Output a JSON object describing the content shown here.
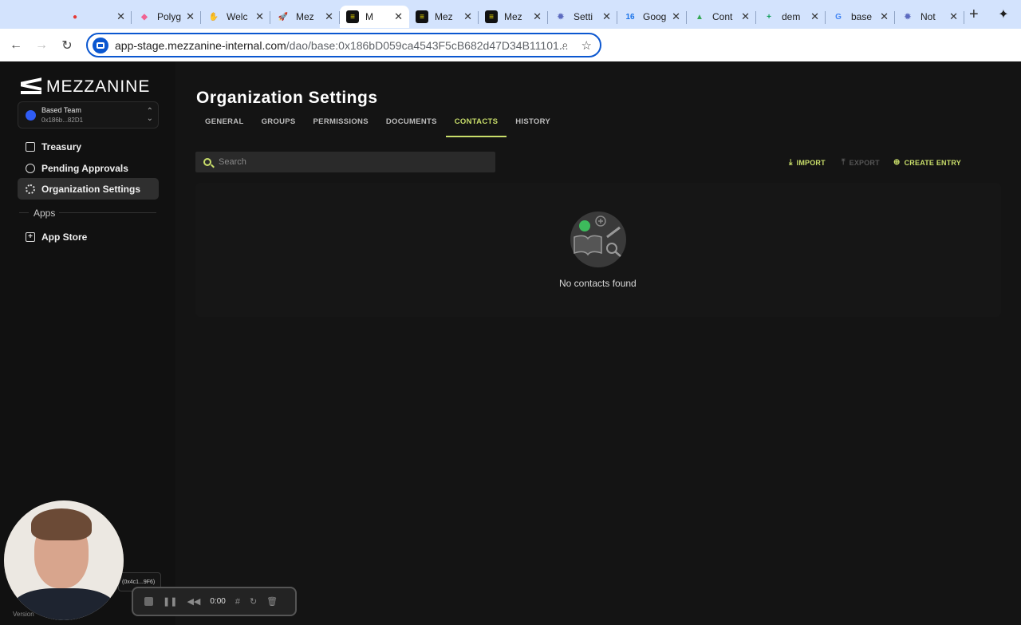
{
  "browser": {
    "tabs": [
      {
        "title": "",
        "fav": "●",
        "fav_color": "#e53935",
        "fav_text": "#e53935"
      },
      {
        "title": "Polyg",
        "fav": "◆",
        "fav_color": "#f06292",
        "fav_text": "#f06292"
      },
      {
        "title": "Welc",
        "fav": "✋",
        "fav_color": "#f9a825",
        "fav_text": "#f9a825"
      },
      {
        "title": "Mez",
        "fav": "🚀",
        "fav_color": "#e53935",
        "fav_text": "#e53935"
      },
      {
        "title": "M",
        "fav": "≡",
        "fav_color": "#111111",
        "fav_text": "#f0e000",
        "active": true
      },
      {
        "title": "Mez",
        "fav": "≡",
        "fav_color": "#111111",
        "fav_text": "#f0e000"
      },
      {
        "title": "Mez",
        "fav": "≡",
        "fav_color": "#111111",
        "fav_text": "#f0e000"
      },
      {
        "title": "Setti",
        "fav": "✹",
        "fav_color": "#5c6bc0",
        "fav_text": "#5c6bc0"
      },
      {
        "title": "Goog",
        "fav": "16",
        "fav_color": "#1a73e8",
        "fav_text": "#1a73e8"
      },
      {
        "title": "Cont",
        "fav": "▲",
        "fav_color": "#34a853",
        "fav_text": "#34a853"
      },
      {
        "title": "dem",
        "fav": "+",
        "fav_color": "#0f9d58",
        "fav_text": "#0f9d58"
      },
      {
        "title": "base",
        "fav": "G",
        "fav_color": "#4285f4",
        "fav_text": "#4285f4"
      },
      {
        "title": "Not",
        "fav": "✹",
        "fav_color": "#5c6bc0",
        "fav_text": "#5c6bc0"
      }
    ],
    "url_main": "app-stage.mezzanine-internal.com",
    "url_path": "/dao/base:0x186bD059ca4543F5cB682d47D34B11101..."
  },
  "sidebar": {
    "logo": "MEZZANINE",
    "team_name": "Based Team",
    "team_address": "0x186b...82D1",
    "nav": [
      {
        "label": "Treasury",
        "icon": "wallet-icon"
      },
      {
        "label": "Pending Approvals",
        "icon": "check-circle-icon"
      },
      {
        "label": "Organization Settings",
        "icon": "gear-icon",
        "active": true
      }
    ],
    "apps_label": "Apps",
    "app_store": "App Store"
  },
  "main": {
    "title": "Organization Settings",
    "tabs": [
      "GENERAL",
      "GROUPS",
      "PERMISSIONS",
      "DOCUMENTS",
      "CONTACTS",
      "HISTORY"
    ],
    "active_tab": "CONTACTS",
    "search_placeholder": "Search",
    "import_label": "IMPORT",
    "export_label": "EXPORT",
    "create_label": "CREATE ENTRY",
    "empty_text": "No contacts found"
  },
  "overlay": {
    "recorder_time": "0:00",
    "wallet_chip": "(0x4c1...9F6)",
    "version": "Version"
  },
  "colors": {
    "accent": "#c9de6a",
    "background": "#141414",
    "sidebar": "#111111"
  }
}
